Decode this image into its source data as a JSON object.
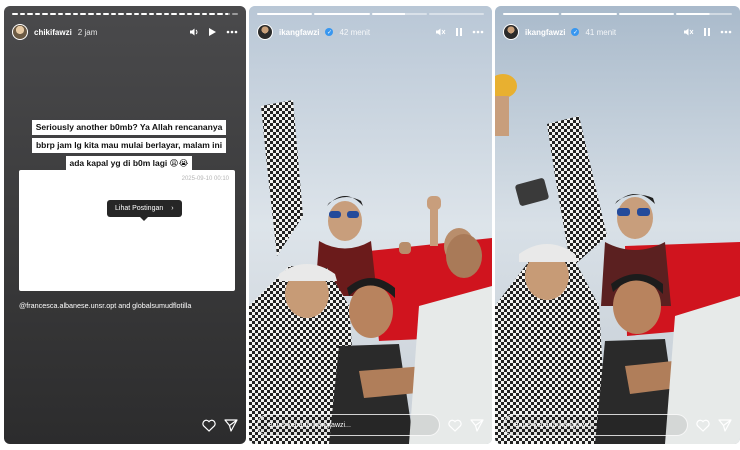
{
  "stories": [
    {
      "username": "chikifawzi",
      "time": "2 jam",
      "caption_lines": [
        "Seriously another b0mb? Ya Allah rencananya",
        "bbrp jam lg kita mau mulai berlayar, malam ini",
        "ada kapal yg di b0m lagi 😩😭"
      ],
      "post_date": "2025-09-10 00:10",
      "view_post_label": "Lihat Postingan",
      "mention": "@francesca.albanese.unsr.opt and globalsumudflotilla"
    },
    {
      "username": "ikangfawzi",
      "time": "42 menit",
      "reply_placeholder": "Balas kepada ikangfawzi..."
    },
    {
      "username": "ikangfawzi",
      "time": "41 menit",
      "reply_placeholder": "Balas kepada ikangfawzi..."
    }
  ],
  "icons": {
    "sound": "speaker-icon",
    "mute": "mute-icon",
    "play": "play-icon",
    "pause": "pause-icon",
    "more": "more-icon",
    "like": "heart-icon",
    "share": "send-icon"
  },
  "colors": {
    "verified_badge": "#3897f0",
    "flag_red": "#d0141e",
    "text_story_bg": "#3f3f40"
  }
}
